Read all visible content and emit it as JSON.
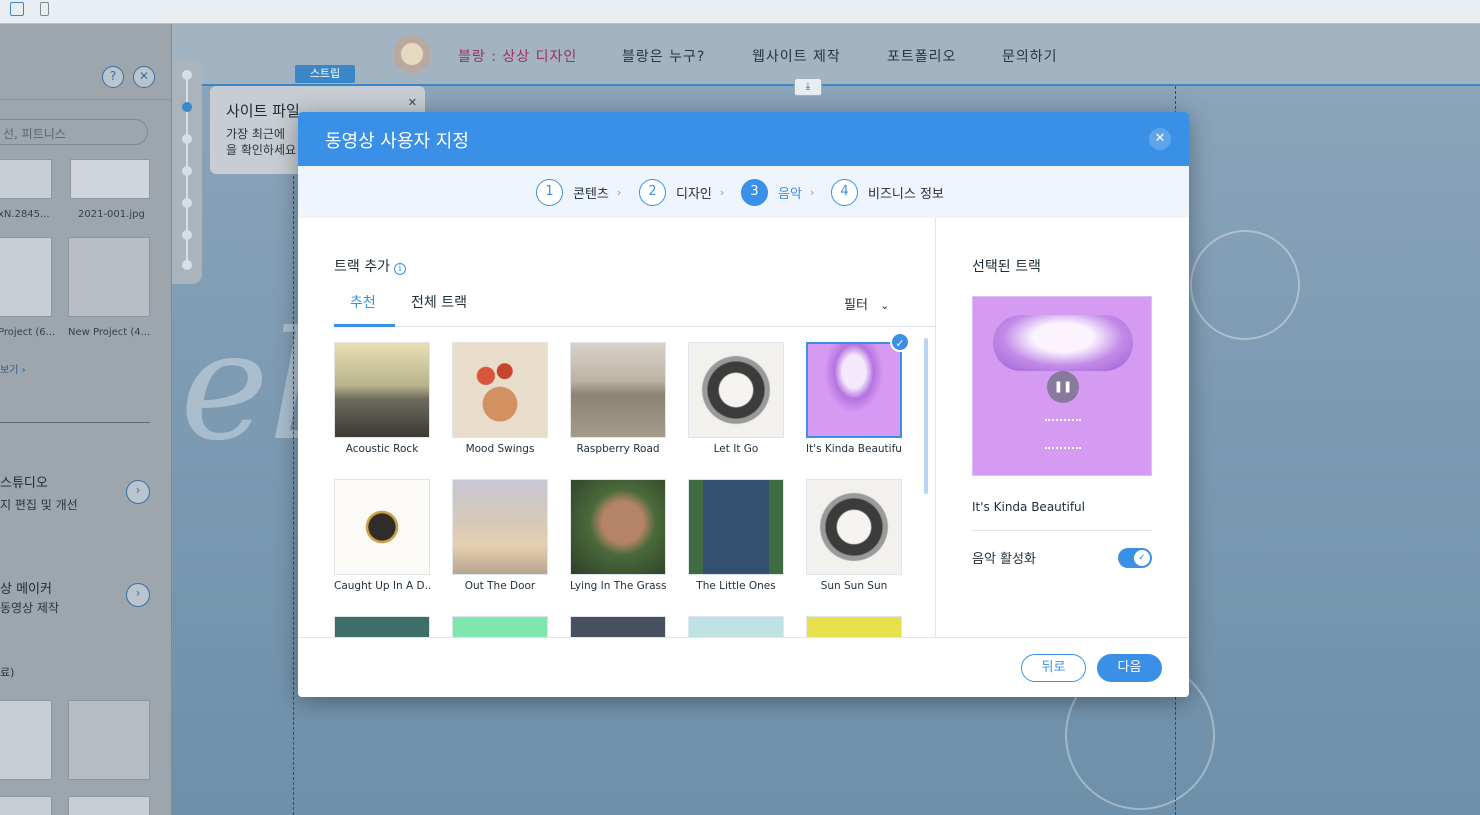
{
  "editor": {
    "site_nav": [
      {
        "label": "블랑 : 상상 디자인"
      },
      {
        "label": "블랑은 누구?"
      },
      {
        "label": "웹사이트 제작"
      },
      {
        "label": "포트폴리오"
      },
      {
        "label": "문의하기"
      }
    ],
    "strip_tag": "스트립",
    "tooltip": {
      "title": "사이트 파일",
      "desc_line1": "가장 최근에",
      "desc_line2": "을 확인하세요"
    },
    "left_panel": {
      "search_placeholder": "선, 피트니스",
      "thumb_captions": [
        "xN.2845...",
        "2021-001.jpg",
        "Project (6...",
        "New Project (4..."
      ],
      "see_more": "보기 ›",
      "section1_title": "스튜디오",
      "section1_sub": "지 편집 및 개선",
      "section2_title": "상 메이커",
      "section2_sub": "동영상 제작",
      "section3_label": "료)",
      "help_icon": "?",
      "close_icon": "✕"
    }
  },
  "modal": {
    "title": "동영상 사용자 지정",
    "steps": [
      {
        "num": "1",
        "label": "콘텐츠"
      },
      {
        "num": "2",
        "label": "디자인"
      },
      {
        "num": "3",
        "label": "음악"
      },
      {
        "num": "4",
        "label": "비즈니스 정보"
      }
    ],
    "active_step": 3,
    "add_track_label": "트랙 추가",
    "tabs": [
      {
        "label": "추천"
      },
      {
        "label": "전체 트랙"
      }
    ],
    "filter_label": "필터",
    "tracks": [
      {
        "name": "Acoustic Rock"
      },
      {
        "name": "Mood Swings"
      },
      {
        "name": "Raspberry Road"
      },
      {
        "name": "Let It Go"
      },
      {
        "name": "It's Kinda Beautiful"
      },
      {
        "name": "Caught Up In A D..."
      },
      {
        "name": "Out The Door"
      },
      {
        "name": "Lying In The Grass"
      },
      {
        "name": "The Little Ones"
      },
      {
        "name": "Sun Sun Sun"
      }
    ],
    "selected_track_index": 4,
    "selected_panel": {
      "title": "선택된 트랙",
      "track_name": "It's Kinda Beautiful",
      "music_toggle_label": "음악 활성화",
      "music_enabled": true
    },
    "back_button": "뒤로",
    "next_button": "다음",
    "accent_color": "#3a90e6"
  }
}
